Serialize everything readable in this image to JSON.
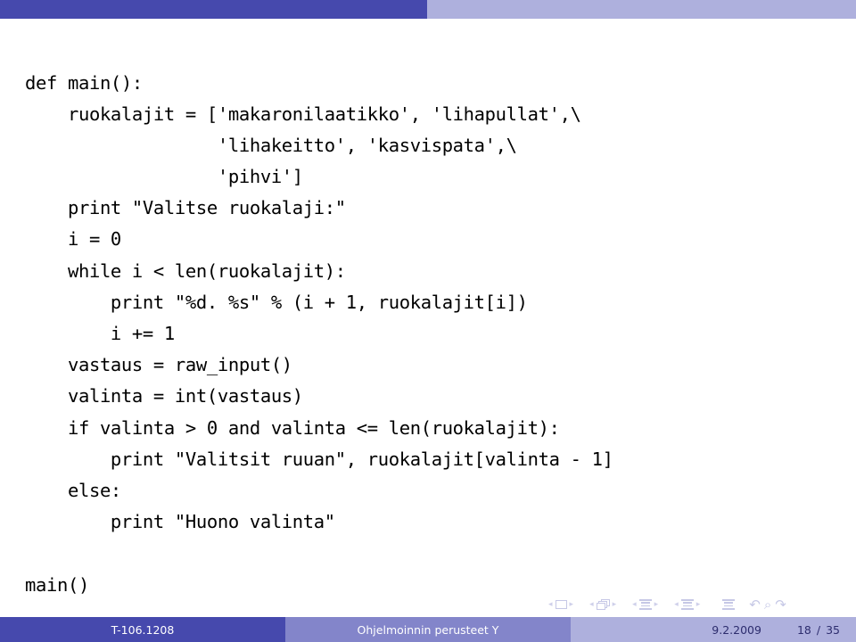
{
  "slide": {
    "code_lines": [
      "def main():",
      "    ruokalajit = ['makaronilaatikko', 'lihapullat',\\",
      "                  'lihakeitto', 'kasvispata',\\",
      "                  'pihvi']",
      "    print \"Valitse ruokalaji:\"",
      "    i = 0",
      "    while i < len(ruokalajit):",
      "        print \"%d. %s\" % (i + 1, ruokalajit[i])",
      "        i += 1",
      "    vastaus = raw_input()",
      "    valinta = int(vastaus)",
      "    if valinta > 0 and valinta <= len(ruokalajit):",
      "        print \"Valitsit ruuan\", ruokalajit[valinta - 1]",
      "    else:",
      "        print \"Huono valinta\"",
      "",
      "main()"
    ]
  },
  "navigation": {
    "groups": [
      {
        "name": "slide",
        "prev": "◂",
        "next": "▸"
      },
      {
        "name": "frame",
        "prev": "◂",
        "next": "▸"
      },
      {
        "name": "subsection",
        "prev": "◂",
        "next": "▸"
      },
      {
        "name": "section",
        "prev": "◂",
        "next": "▸"
      }
    ],
    "doc_label": "document",
    "back_symbol": "↶",
    "search_symbol": "⌕",
    "forward_symbol": "↷"
  },
  "footer": {
    "course_code": "T-106.1208",
    "title": "Ohjelmoinnin perusteet Y",
    "date": "9.2.2009",
    "page_current": "18",
    "page_separator": "/",
    "page_total": "35"
  },
  "theme": {
    "primary_dark": "#4649ad",
    "primary_mid": "#8385ca",
    "primary_light": "#aeb0dd",
    "nav_symbol_color": "#c6c8e6",
    "code_color": "#000000",
    "background": "#ffffff"
  }
}
